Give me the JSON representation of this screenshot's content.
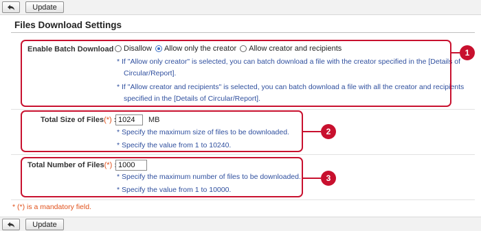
{
  "toolbar": {
    "update_label": "Update",
    "back_icon": "back-arrow-icon"
  },
  "panel": {
    "title": "Files Download Settings"
  },
  "batch_download": {
    "label": "Enable Batch Download",
    "colon": ":",
    "options": [
      "Disallow",
      "Allow only the creator",
      "Allow creator and recipients"
    ],
    "selected": "Allow only the creator",
    "notes": [
      "* If \"Allow only creator\" is selected, you can batch download a file with the creator specified in the [Details of",
      "Circular/Report].",
      "* If \"Allow creator and recipients\" is selected, you can batch download a file with all the creator and recipients",
      "specified in the [Details of Circular/Report]."
    ],
    "badge": "1"
  },
  "total_size": {
    "label": "Total Size of Files",
    "required_mark": "(*)",
    "colon": ":",
    "value": "1024",
    "unit": "MB",
    "notes": [
      "* Specify the maximum size of files to be downloaded.",
      "* Specify the value from 1 to 10240."
    ],
    "badge": "2"
  },
  "total_number": {
    "label": "Total Number of Files",
    "required_mark": "(*)",
    "colon": ":",
    "value": "1000",
    "notes": [
      "* Specify the maximum number of files to be downloaded.",
      "* Specify the value from 1 to 10000."
    ],
    "badge": "3"
  },
  "mandatory_note": "* (*) is a mandatory field.",
  "colors": {
    "highlight": "#c8102e",
    "note_text": "#2f4f9e",
    "required": "#e0501a"
  }
}
